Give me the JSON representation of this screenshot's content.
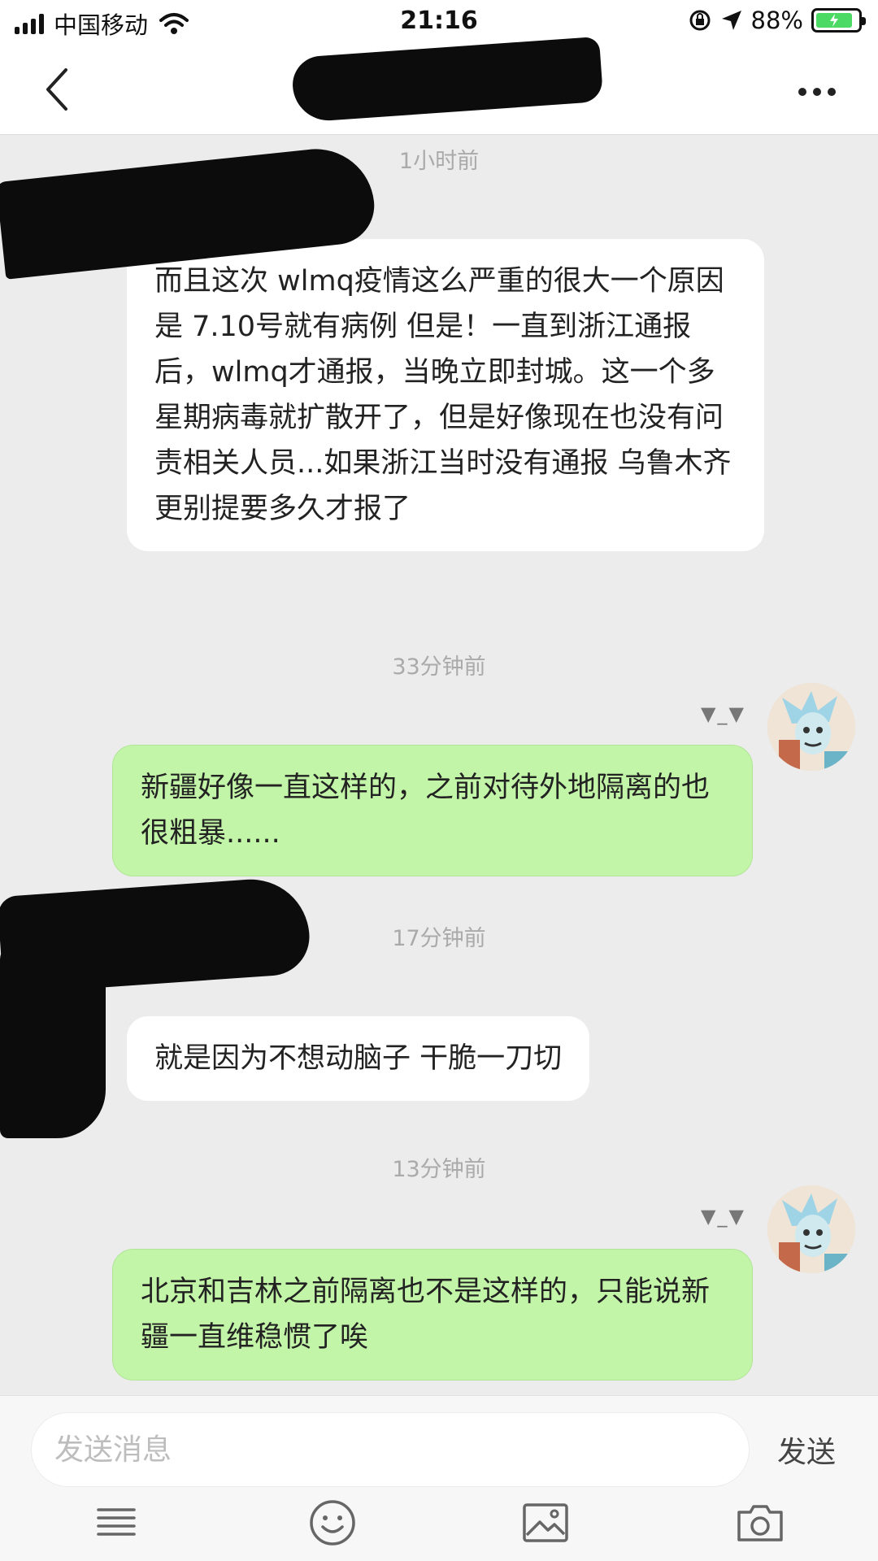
{
  "status_bar": {
    "carrier": "中国移动",
    "time": "21:16",
    "battery_percent": "88%",
    "battery_level": 0.88,
    "icons": [
      "signal-icon",
      "wifi-icon",
      "orientation-lock-icon",
      "location-icon",
      "battery-icon"
    ]
  },
  "header": {
    "title": "",
    "back_icon": "chevron-left-icon",
    "more_icon": "more-dots-icon"
  },
  "messages": [
    {
      "time": "1小时前",
      "direction": "incoming",
      "text": "而且这次 wlmq疫情这么严重的很大一个原因是 7.10号就有病例 但是！一直到浙江通报后，wlmq才通报，当晚立即封城。这一个多星期病毒就扩散开了，但是好像现在也没有问责相关人员...如果浙江当时没有通报 乌鲁木齐更别提要多久才报了"
    },
    {
      "time": "33分钟前",
      "direction": "outgoing",
      "nickname": "▼_▼",
      "text": "新疆好像一直这样的，之前对待外地隔离的也很粗暴......"
    },
    {
      "time": "17分钟前",
      "direction": "incoming",
      "text": "就是因为不想动脑子 干脆一刀切"
    },
    {
      "time": "13分钟前",
      "direction": "outgoing",
      "nickname": "▼_▼",
      "text": "北京和吉林之前隔离也不是这样的，只能说新疆一直维稳惯了唉"
    }
  ],
  "input_bar": {
    "placeholder": "发送消息",
    "send_label": "发送",
    "tools": [
      "list-icon",
      "emoji-icon",
      "image-icon",
      "camera-icon"
    ]
  },
  "colors": {
    "outgoing_bubble": "#c3f5a8",
    "incoming_bubble": "#ffffff",
    "chat_background": "#ececec",
    "battery_fill": "#4cd964"
  }
}
